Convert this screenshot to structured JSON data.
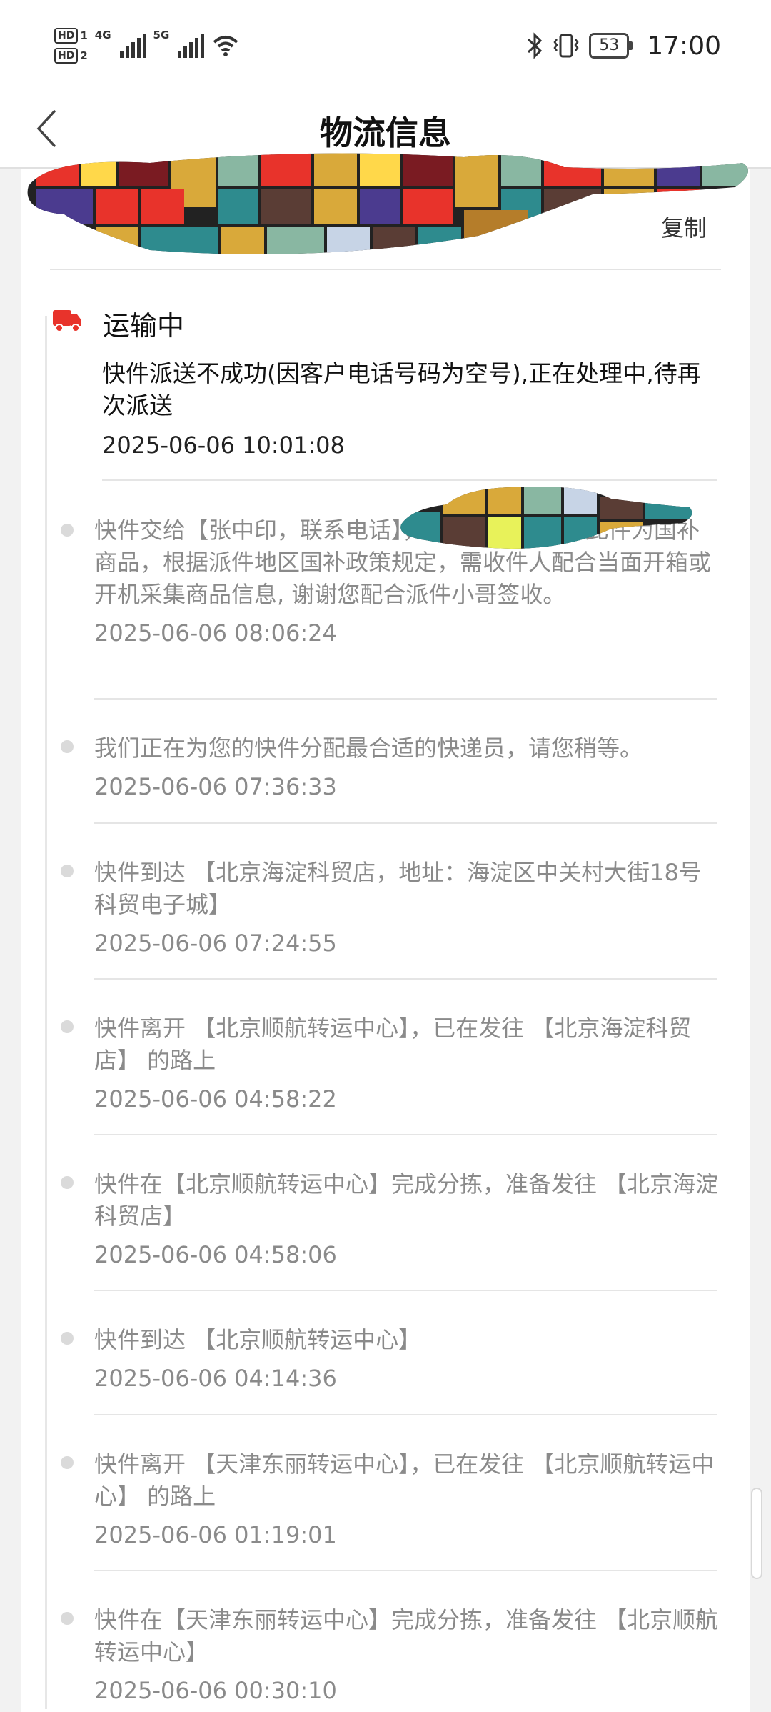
{
  "status_bar": {
    "hd1": "HD",
    "sim1": "1",
    "hd2": "HD",
    "sim2": "2",
    "net1": "4G",
    "net2": "5G",
    "battery": "53",
    "time": "17:00",
    "icons": [
      "bluetooth-icon",
      "vibrate-icon",
      "wifi-icon",
      "signal-icon"
    ]
  },
  "header": {
    "title": "物流信息"
  },
  "card": {
    "copy_label": "复制"
  },
  "current": {
    "status": "运输中",
    "description": "快件派送不成功(因客户电话号码为空号),正在处理中,待再次派送",
    "time": "2025-06-06 10:01:08"
  },
  "events": [
    {
      "description": "快件交给【张中印，联系电话",
      "description_tail": "】，正在派送途中，此件为国补商品，根据派件地区国补政策规定，需收件人配合当面开箱或开机采集商品信息, 谢谢您配合派件小哥签收。",
      "time": "2025-06-06 08:06:24"
    },
    {
      "description": "我们正在为您的快件分配最合适的快递员，请您稍等。",
      "time": "2025-06-06 07:36:33"
    },
    {
      "description": "快件到达 【北京海淀科贸店，地址：海淀区中关村大街18号科贸电子城】",
      "time": "2025-06-06 07:24:55"
    },
    {
      "description": "快件离开 【北京顺航转运中心】，已在发往 【北京海淀科贸店】 的路上",
      "time": "2025-06-06 04:58:22"
    },
    {
      "description": "快件在【北京顺航转运中心】完成分拣，准备发往 【北京海淀科贸店】",
      "time": "2025-06-06 04:58:06"
    },
    {
      "description": "快件到达 【北京顺航转运中心】",
      "time": "2025-06-06 04:14:36"
    },
    {
      "description": "快件离开 【天津东丽转运中心】，已在发往 【北京顺航转运中心】 的路上",
      "time": "2025-06-06 01:19:01"
    },
    {
      "description": "快件在【天津东丽转运中心】完成分拣，准备发往 【北京顺航转运中心】",
      "time": "2025-06-06 00:30:10"
    }
  ],
  "colors": {
    "accent_red": "#e8332b",
    "text_gray": "#8a8a8a"
  }
}
